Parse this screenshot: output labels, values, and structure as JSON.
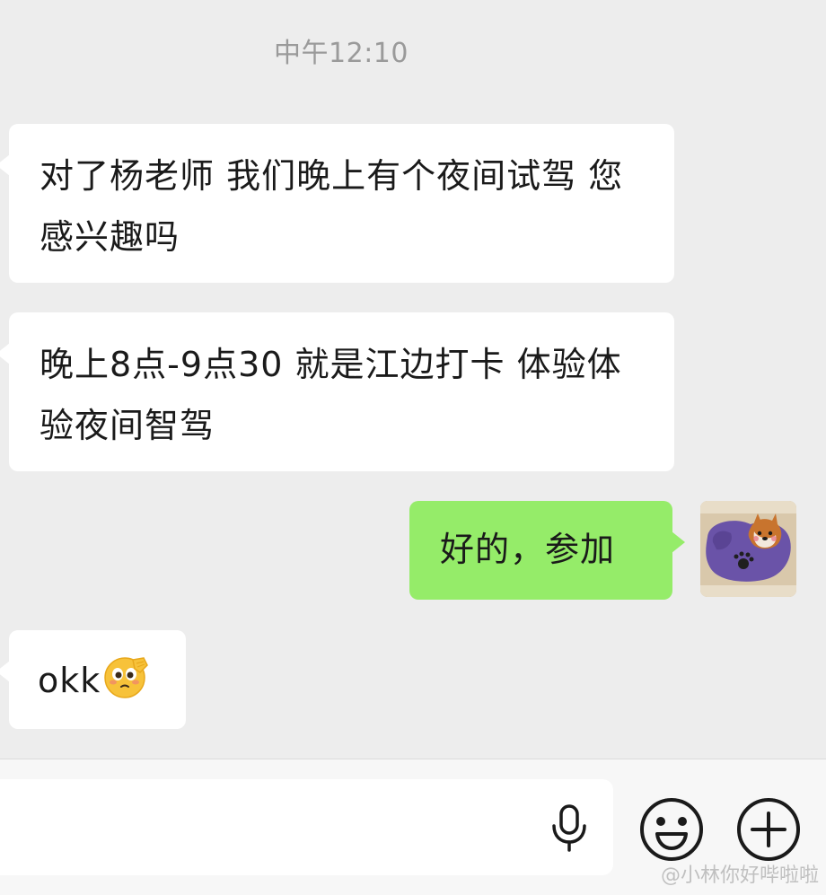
{
  "chat": {
    "timestamp": "中午12:10",
    "messages": [
      {
        "side": "left",
        "text": "对了杨老师 我们晚上有个夜间试驾 您感兴趣吗"
      },
      {
        "side": "left",
        "text": "晚上8点-9点30 就是江边打卡 体验体验夜间智驾"
      },
      {
        "side": "right",
        "text": "好的，参加"
      },
      {
        "side": "left",
        "text": "okk",
        "emoji": "salute-face-emoji"
      }
    ],
    "avatar_icon": "shiba-dog-avatar"
  },
  "input_bar": {
    "input_value": "",
    "mic_icon": "microphone-icon",
    "emoji_icon": "smiley-face-icon",
    "plus_icon": "plus-circle-icon"
  },
  "watermark": {
    "text": "@小林你好哔啦啦"
  },
  "colors": {
    "chat_background": "#ededed",
    "left_bubble": "#ffffff",
    "right_bubble": "#95ec69",
    "timestamp_text": "#9a9a9a"
  }
}
